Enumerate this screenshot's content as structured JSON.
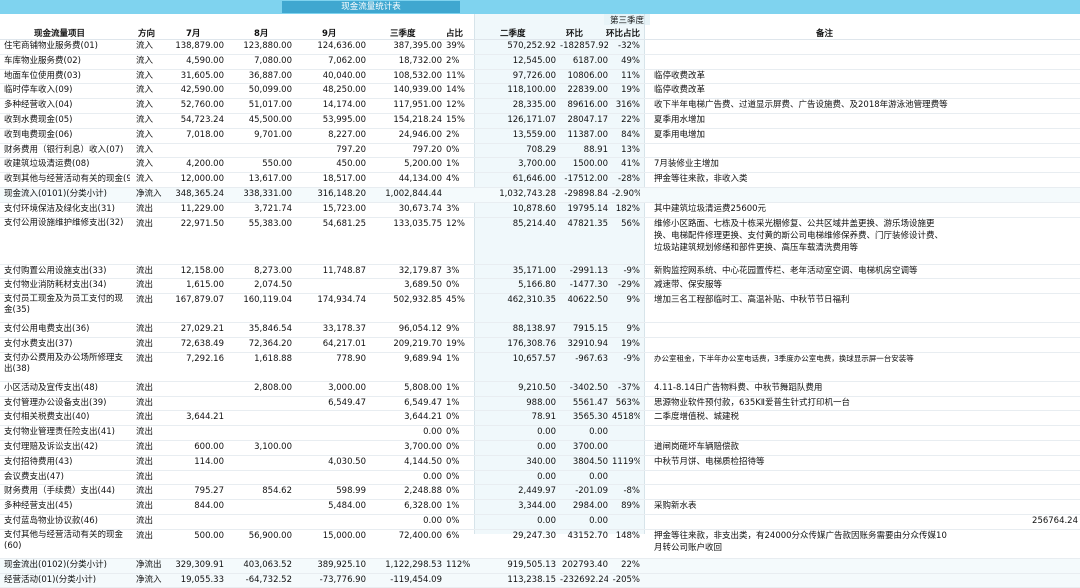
{
  "title": "现金流量统计表",
  "headers": {
    "name": "现金流量项目",
    "direction": "方向",
    "jul": "7月",
    "aug": "8月",
    "sep": "9月",
    "q3": "三季度",
    "pct": "占比",
    "q2": "二季度",
    "hb": "环比",
    "q3tag": "第三季度",
    "hbp": "环比占比",
    "note": "备注"
  },
  "rows": [
    {
      "name": "住宅商铺物业服务费(01)",
      "dir": "流入",
      "jul": "138,879.00",
      "aug": "123,880.00",
      "sep": "124,636.00",
      "q3": "387,395.00",
      "pct": "39%",
      "q2": "570,252.92",
      "hb": "-182857.92",
      "hbp": "-32%",
      "note": ""
    },
    {
      "name": "车库物业服务费(02)",
      "dir": "流入",
      "jul": "4,590.00",
      "aug": "7,080.00",
      "sep": "7,062.00",
      "q3": "18,732.00",
      "pct": "2%",
      "q2": "12,545.00",
      "hb": "6187.00",
      "hbp": "49%",
      "note": ""
    },
    {
      "name": "地面车位使用费(03)",
      "dir": "流入",
      "jul": "31,605.00",
      "aug": "36,887.00",
      "sep": "40,040.00",
      "q3": "108,532.00",
      "pct": "11%",
      "q2": "97,726.00",
      "hb": "10806.00",
      "hbp": "11%",
      "note": "临停收费改革"
    },
    {
      "name": "临时停车收入(09)",
      "dir": "流入",
      "jul": "42,590.00",
      "aug": "50,099.00",
      "sep": "48,250.00",
      "q3": "140,939.00",
      "pct": "14%",
      "q2": "118,100.00",
      "hb": "22839.00",
      "hbp": "19%",
      "note": "临停收费改革"
    },
    {
      "name": "多种经营收入(04)",
      "dir": "流入",
      "jul": "52,760.00",
      "aug": "51,017.00",
      "sep": "14,174.00",
      "q3": "117,951.00",
      "pct": "12%",
      "q2": "28,335.00",
      "hb": "89616.00",
      "hbp": "316%",
      "note": "收下半年电梯广告费、过道显示屏费、广告设施费、及2018年游泳池管理费等"
    },
    {
      "name": "收到水费现金(05)",
      "dir": "流入",
      "jul": "54,723.24",
      "aug": "45,500.00",
      "sep": "53,995.00",
      "q3": "154,218.24",
      "pct": "15%",
      "q2": "126,171.07",
      "hb": "28047.17",
      "hbp": "22%",
      "note": "夏季用水增加"
    },
    {
      "name": "收到电费现金(06)",
      "dir": "流入",
      "jul": "7,018.00",
      "aug": "9,701.00",
      "sep": "8,227.00",
      "q3": "24,946.00",
      "pct": "2%",
      "q2": "13,559.00",
      "hb": "11387.00",
      "hbp": "84%",
      "note": "夏季用电增加"
    },
    {
      "name": "财务费用（银行利息）收入(07)",
      "dir": "流入",
      "jul": "",
      "aug": "",
      "sep": "797.20",
      "q3": "797.20",
      "pct": "0%",
      "q2": "708.29",
      "hb": "88.91",
      "hbp": "13%",
      "note": ""
    },
    {
      "name": "收建筑垃圾清运费(08)",
      "dir": "流入",
      "jul": "4,200.00",
      "aug": "550.00",
      "sep": "450.00",
      "q3": "5,200.00",
      "pct": "1%",
      "q2": "3,700.00",
      "hb": "1500.00",
      "hbp": "41%",
      "note": "7月装修业主增加"
    },
    {
      "name": "收到其他与经营活动有关的现金(99)",
      "dir": "流入",
      "jul": "12,000.00",
      "aug": "13,617.00",
      "sep": "18,517.00",
      "q3": "44,134.00",
      "pct": "4%",
      "q2": "61,646.00",
      "hb": "-17512.00",
      "hbp": "-28%",
      "note": "押金等往来款，非收入类"
    },
    {
      "name": "现金流入(0101)(分类小计)",
      "dir": "净流入",
      "jul": "348,365.24",
      "aug": "338,331.00",
      "sep": "316,148.20",
      "q3": "1,002,844.44",
      "pct": "",
      "q2": "1,032,743.28",
      "hb": "-29898.84",
      "hbp": "-2.90%",
      "note": "",
      "sum": true
    },
    {
      "name": "支付环境保洁及绿化支出(31)",
      "dir": "流出",
      "jul": "11,229.00",
      "aug": "3,721.74",
      "sep": "15,723.00",
      "q3": "30,673.74",
      "pct": "3%",
      "q2": "10,878.60",
      "hb": "19795.14",
      "hbp": "182%",
      "note": "其中建筑垃圾清运费25600元"
    },
    {
      "name": "支付公用设施维护维修支出(32)",
      "dir": "流出",
      "jul": "22,971.50",
      "aug": "55,383.00",
      "sep": "54,681.25",
      "q3": "133,035.75",
      "pct": "12%",
      "q2": "85,214.40",
      "hb": "47821.35",
      "hbp": "56%",
      "note": "维修小区路面、七栋及十栋采光棚修复、公共区域井盖更换、游乐场设施更换、电梯配件修理更换、支付黄的斯公司电梯维修保养费、门厅装修设计费、垃圾站建筑规划修缮和部件更换、高压车载清洗费用等",
      "xtall": true
    },
    {
      "name": "支付购置公用设施支出(33)",
      "dir": "流出",
      "jul": "12,158.00",
      "aug": "8,273.00",
      "sep": "11,748.87",
      "q3": "32,179.87",
      "pct": "3%",
      "q2": "35,171.00",
      "hb": "-2991.13",
      "hbp": "-9%",
      "note": "新购监控网系统、中心花园置传栏、老年活动室空调、电梯机房空调等"
    },
    {
      "name": "支付物业消防耗材支出(34)",
      "dir": "流出",
      "jul": "1,615.00",
      "aug": "2,074.50",
      "sep": "",
      "q3": "3,689.50",
      "pct": "0%",
      "q2": "5,166.80",
      "hb": "-1477.30",
      "hbp": "-29%",
      "note": "减速带、保安服等"
    },
    {
      "name": "支付员工现金及为员工支付的现金(35)",
      "dir": "流出",
      "jul": "167,879.07",
      "aug": "160,119.04",
      "sep": "174,934.74",
      "q3": "502,932.85",
      "pct": "45%",
      "q2": "462,310.35",
      "hb": "40622.50",
      "hbp": "9%",
      "note": "增加三名工程部临时工、高温补贴、中秋节节日福利",
      "tall": true
    },
    {
      "name": "支付公用电费支出(36)",
      "dir": "流出",
      "jul": "27,029.21",
      "aug": "35,846.54",
      "sep": "33,178.37",
      "q3": "96,054.12",
      "pct": "9%",
      "q2": "88,138.97",
      "hb": "7915.15",
      "hbp": "9%",
      "note": ""
    },
    {
      "name": "支付水费支出(37)",
      "dir": "流出",
      "jul": "72,638.49",
      "aug": "72,364.20",
      "sep": "64,217.01",
      "q3": "209,219.70",
      "pct": "19%",
      "q2": "176,308.76",
      "hb": "32910.94",
      "hbp": "19%",
      "note": ""
    },
    {
      "name": "支付办公费用及办公场所修理支出(38)",
      "dir": "流出",
      "jul": "7,292.16",
      "aug": "1,618.88",
      "sep": "778.90",
      "q3": "9,689.94",
      "pct": "1%",
      "q2": "10,657.57",
      "hb": "-967.63",
      "hbp": "-9%",
      "note": "办公室租金，下半年办公室电话费，3季度办公室电费，换球显示屏一台安装等",
      "tall": true,
      "smallnote": true
    },
    {
      "name": "小区活动及宣传支出(48)",
      "dir": "流出",
      "jul": "",
      "aug": "2,808.00",
      "sep": "3,000.00",
      "q3": "5,808.00",
      "pct": "1%",
      "q2": "9,210.50",
      "hb": "-3402.50",
      "hbp": "-37%",
      "note": "4.11-8.14日广告物料费、中秋节舞蹈队费用"
    },
    {
      "name": "支付管理办公设备支出(39)",
      "dir": "流出",
      "jul": "",
      "aug": "",
      "sep": "6,549.47",
      "q3": "6,549.47",
      "pct": "1%",
      "q2": "988.00",
      "hb": "5561.47",
      "hbp": "563%",
      "note": "思源物业软件预付款，635KⅡ爱普生针式打印机一台"
    },
    {
      "name": "支付相关税费支出(40)",
      "dir": "流出",
      "jul": "3,644.21",
      "aug": "",
      "sep": "",
      "q3": "3,644.21",
      "pct": "0%",
      "q2": "78.91",
      "hb": "3565.30",
      "hbp": "4518%",
      "note": "二季度增值税、城建税"
    },
    {
      "name": "支付物业管理责任险支出(41)",
      "dir": "流出",
      "jul": "",
      "aug": "",
      "sep": "",
      "q3": "0.00",
      "pct": "0%",
      "q2": "0.00",
      "hb": "0.00",
      "hbp": "",
      "note": ""
    },
    {
      "name": "支付理赔及诉讼支出(42)",
      "dir": "流出",
      "jul": "600.00",
      "aug": "3,100.00",
      "sep": "",
      "q3": "3,700.00",
      "pct": "0%",
      "q2": "0.00",
      "hb": "3700.00",
      "hbp": "",
      "note": "道闸岗砸坏车辆赔偿款"
    },
    {
      "name": "支付招待费用(43)",
      "dir": "流出",
      "jul": "114.00",
      "aug": "",
      "sep": "4,030.50",
      "q3": "4,144.50",
      "pct": "0%",
      "q2": "340.00",
      "hb": "3804.50",
      "hbp": "1119%",
      "note": "中秋节月饼、电梯质检招待等"
    },
    {
      "name": "会议费支出(47)",
      "dir": "流出",
      "jul": "",
      "aug": "",
      "sep": "",
      "q3": "0.00",
      "pct": "0%",
      "q2": "0.00",
      "hb": "0.00",
      "hbp": "",
      "note": ""
    },
    {
      "name": "财务费用（手续费）支出(44)",
      "dir": "流出",
      "jul": "795.27",
      "aug": "854.62",
      "sep": "598.99",
      "q3": "2,248.88",
      "pct": "0%",
      "q2": "2,449.97",
      "hb": "-201.09",
      "hbp": "-8%",
      "note": ""
    },
    {
      "name": "多种经营支出(45)",
      "dir": "流出",
      "jul": "844.00",
      "aug": "",
      "sep": "5,484.00",
      "q3": "6,328.00",
      "pct": "1%",
      "q2": "3,344.00",
      "hb": "2984.00",
      "hbp": "89%",
      "note": "采购新水表"
    },
    {
      "name": "支付蓝岛物业协议款(46)",
      "dir": "流出",
      "jul": "",
      "aug": "",
      "sep": "",
      "q3": "0.00",
      "pct": "0%",
      "q2": "0.00",
      "hb": "0.00",
      "hbp": "",
      "note": "",
      "extra": "256764.24"
    },
    {
      "name": "支付其他与经营活动有关的现金(60)",
      "dir": "流出",
      "jul": "500.00",
      "aug": "56,900.00",
      "sep": "15,000.00",
      "q3": "72,400.00",
      "pct": "6%",
      "q2": "29,247.30",
      "hb": "43152.70",
      "hbp": "148%",
      "note": "押金等往来款，非支出类，有24000分众传媒广告款因账务需要由分众传媒10月转公司账户收回",
      "tall": true
    },
    {
      "name": "现金流出(0102)(分类小计)",
      "dir": "净流出",
      "jul": "329,309.91",
      "aug": "403,063.52",
      "sep": "389,925.10",
      "q3": "1,122,298.53",
      "pct": "112%",
      "q2": "919,505.13",
      "hb": "202793.40",
      "hbp": "22%",
      "note": "",
      "sum": true
    },
    {
      "name": "经营活动(01)(分类小计)",
      "dir": "净流入",
      "jul": "19,055.33",
      "aug": "-64,732.52",
      "sep": "-73,776.90",
      "q3": "-119,454.09",
      "pct": "",
      "q2": "113,238.15",
      "hb": "-232692.24",
      "hbp": "-205%",
      "note": "",
      "sum": true
    }
  ]
}
